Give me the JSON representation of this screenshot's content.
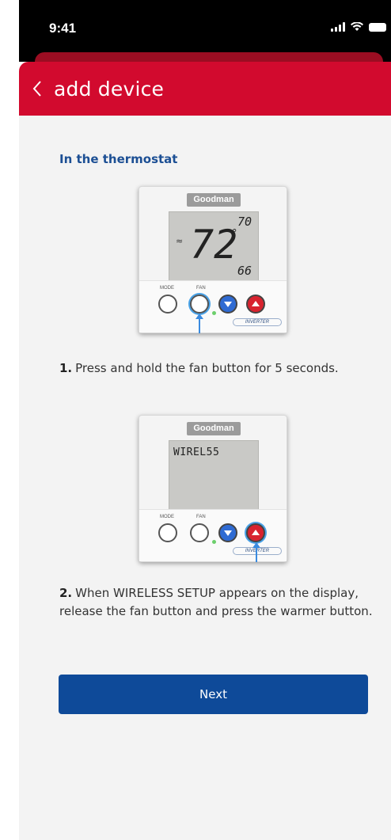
{
  "status_bar": {
    "time": "9:41"
  },
  "header": {
    "title": "add device"
  },
  "section": {
    "title": "In the thermostat"
  },
  "thermostat1": {
    "brand": "Goodman",
    "current_temp": "72",
    "setpoint_high": "70",
    "setpoint_low": "66",
    "mode_label": "MODE",
    "fan_label": "FAN",
    "inverter_label": "INVERTER"
  },
  "thermostat2": {
    "brand": "Goodman",
    "display_text": "WIREL55",
    "mode_label": "MODE",
    "fan_label": "FAN",
    "inverter_label": "INVERTER"
  },
  "steps": [
    {
      "number": "1.",
      "text": "Press and hold the fan button for 5 seconds."
    },
    {
      "number": "2.",
      "text": "When WIRELESS SETUP appears on the display, release the fan button and press the warmer button."
    }
  ],
  "next_button": {
    "label": "Next"
  },
  "colors": {
    "header_red": "#d20a2e",
    "primary_blue": "#0e4a99",
    "title_blue": "#1c4f94"
  }
}
